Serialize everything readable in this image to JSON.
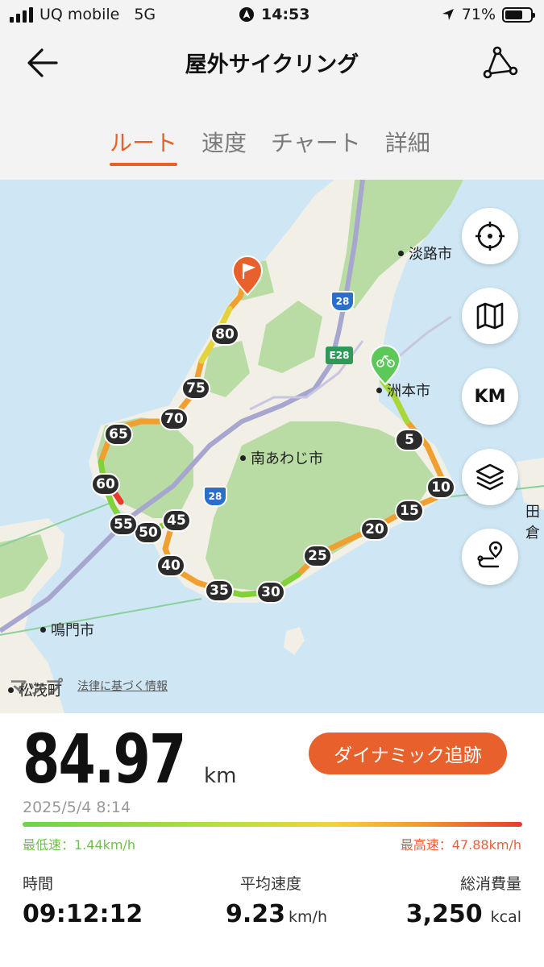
{
  "status_bar": {
    "carrier": "UQ mobile",
    "network": "5G",
    "time": "14:53",
    "battery": "71%",
    "battery_level": 0.71
  },
  "header": {
    "title": "屋外サイクリング",
    "tabs": [
      {
        "label": "ルート",
        "active": true
      },
      {
        "label": "速度",
        "active": false
      },
      {
        "label": "チャート",
        "active": false
      },
      {
        "label": "詳細",
        "active": false
      }
    ]
  },
  "map": {
    "cities": [
      "淡路市",
      "洲本市",
      "南あわじ市",
      "鳴門市",
      "松茂町",
      "田倉"
    ],
    "road_labels": [
      "28",
      "E28",
      "28"
    ],
    "km_markers": [
      "5",
      "10",
      "15",
      "20",
      "25",
      "30",
      "35",
      "40",
      "45",
      "50",
      "55",
      "60",
      "65",
      "70",
      "75",
      "80"
    ],
    "buttons": {
      "km": "KM"
    },
    "footer_logo": "マップ",
    "footer_legal": "法律に基づく情報"
  },
  "summary": {
    "distance": "84.97",
    "distance_unit": "km",
    "dynamic_button": "ダイナミック追跡",
    "datetime": "2025/5/4 8:14",
    "min_speed": "最低速：1.44km/h",
    "max_speed": "最高速：47.88km/h",
    "stats": {
      "time_label": "時間",
      "time_value": "09:12:12",
      "avg_label": "平均速度",
      "avg_value": "9.23",
      "avg_unit": "km/h",
      "cal_label": "総消費量",
      "cal_value": "3,250",
      "cal_unit": "kcal"
    }
  },
  "colors": {
    "accent": "#e8612c",
    "route_start": "#5cc85a",
    "speed_low": "#6fd24a",
    "speed_high": "#e83a2e"
  }
}
